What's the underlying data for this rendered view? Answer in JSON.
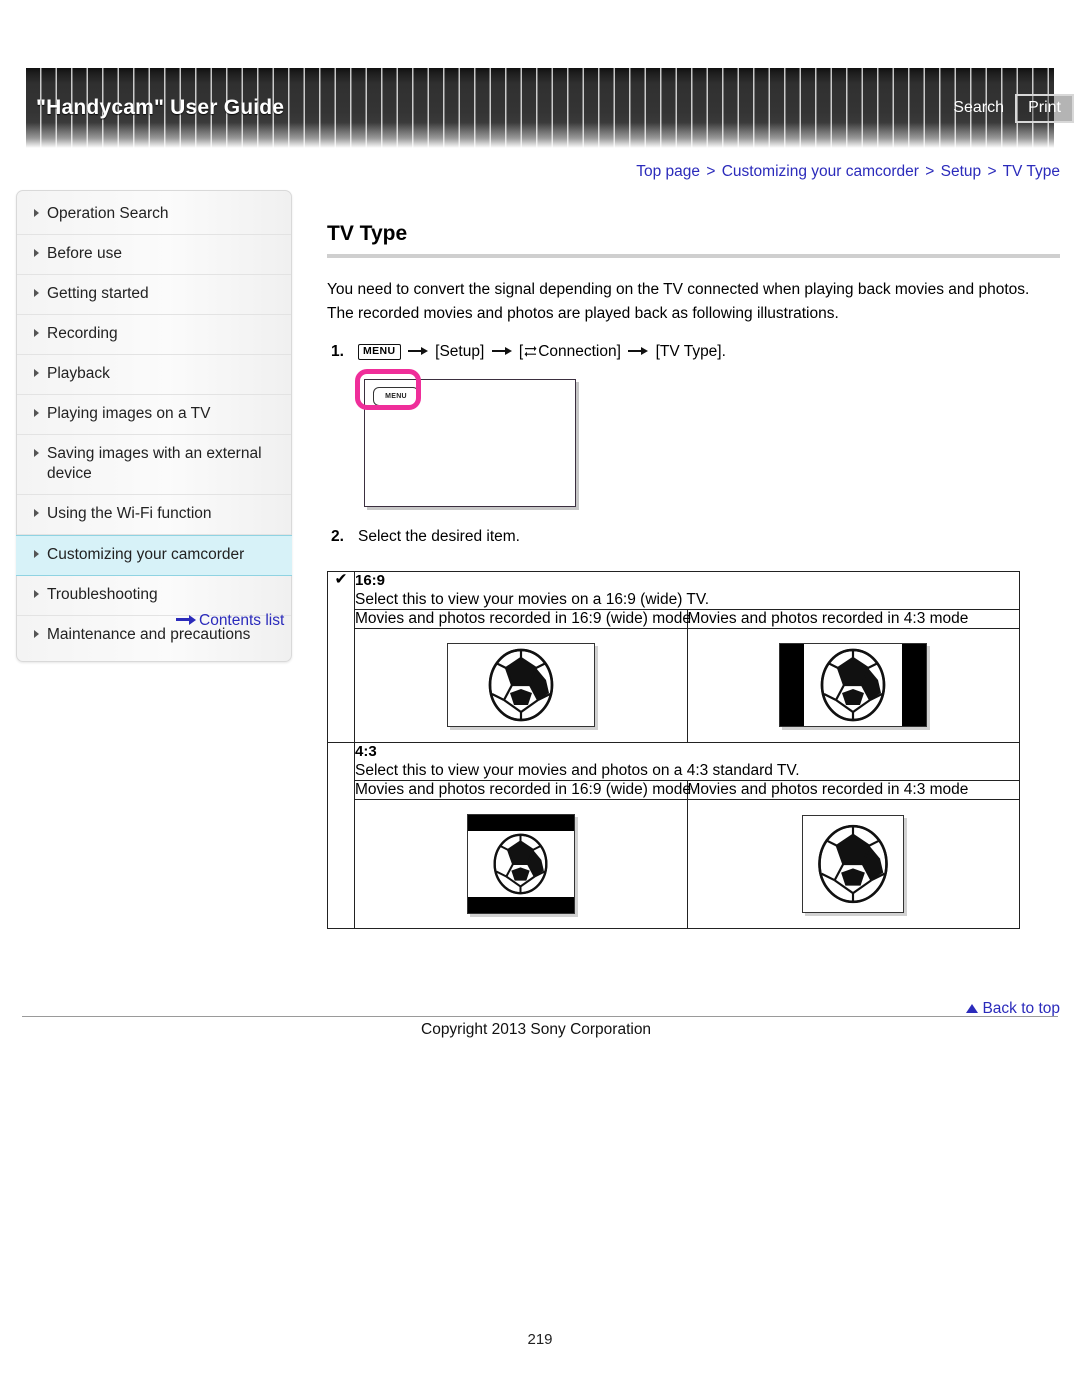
{
  "header": {
    "title": "\"Handycam\" User Guide",
    "search_label": "Search",
    "print_label": "Print"
  },
  "breadcrumb": {
    "items": [
      "Top page",
      "Customizing your camcorder",
      "Setup",
      "TV Type"
    ],
    "separator": ">",
    "color": "#2b2bbb"
  },
  "sidebar": {
    "items": [
      {
        "label": "Operation Search",
        "active": false
      },
      {
        "label": "Before use",
        "active": false
      },
      {
        "label": "Getting started",
        "active": false
      },
      {
        "label": "Recording",
        "active": false
      },
      {
        "label": "Playback",
        "active": false
      },
      {
        "label": "Playing images on a TV",
        "active": false
      },
      {
        "label": "Saving images with an external device",
        "active": false
      },
      {
        "label": "Using the Wi-Fi function",
        "active": false
      },
      {
        "label": "Customizing your camcorder",
        "active": true
      },
      {
        "label": "Troubleshooting",
        "active": false
      },
      {
        "label": "Maintenance and precautions",
        "active": false
      }
    ],
    "contents_list_label": "Contents list",
    "active_bg": "#d7f2f8"
  },
  "main": {
    "title": "TV Type",
    "intro": "You need to convert the signal depending on the TV connected when playing back movies and photos. The recorded movies and photos are played back as following illustrations.",
    "step1": {
      "number": "1.",
      "menu_badge": "MENU",
      "setup_label": "[Setup]",
      "connection_label": "Connection]",
      "connection_open_bracket": "[",
      "tvtype_label": "[TV Type].",
      "connection_icon": "connection-arrows-icon"
    },
    "illustration": {
      "menu_button_label": "MENU",
      "highlight_color": "#ef2e9a"
    },
    "step2": {
      "number": "2.",
      "text": "Select the desired item."
    }
  },
  "table": {
    "col_headers": [
      "Movies and photos recorded in 16:9 (wide) mode",
      "Movies and photos recorded in 4:3 mode"
    ],
    "rows": [
      {
        "selected": true,
        "check_glyph": "✔",
        "option": "16:9",
        "description": "Select this to view your movies on a 16:9 (wide) TV.",
        "left_image": {
          "aspect": "wide",
          "bars": "none"
        },
        "right_image": {
          "aspect": "wide",
          "bars": "vertical"
        }
      },
      {
        "selected": false,
        "check_glyph": "",
        "option": "4:3",
        "description": "Select this to view your movies and photos on a 4:3 standard TV.",
        "left_image": {
          "aspect": "standard",
          "bars": "horizontal"
        },
        "right_image": {
          "aspect": "standard",
          "bars": "none"
        }
      }
    ]
  },
  "footer": {
    "back_to_top_label": "Back to top",
    "copyright": "Copyright 2013 Sony Corporation",
    "page_number": "219"
  }
}
